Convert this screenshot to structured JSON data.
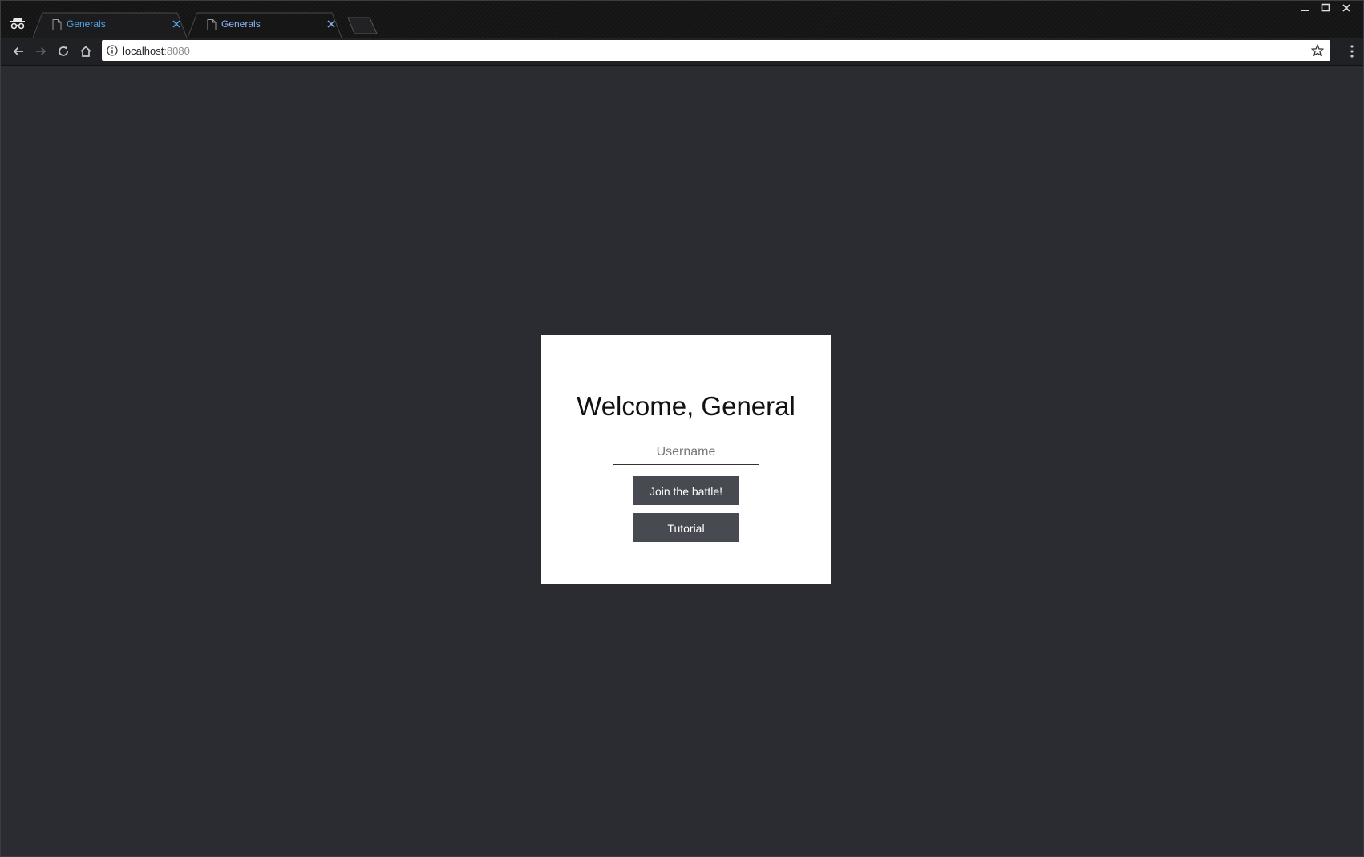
{
  "browser": {
    "tabs": [
      {
        "title": "Generals",
        "active": true
      },
      {
        "title": "Generals",
        "active": false
      }
    ],
    "address": {
      "host": "localhost",
      "port": ":8080"
    },
    "icons": {
      "incognito": "incognito-icon",
      "back": "back-arrow-icon",
      "forward": "forward-arrow-icon",
      "reload": "reload-icon",
      "home": "home-icon",
      "info": "info-icon",
      "bookmark": "star-icon",
      "menu": "kebab-menu-icon"
    },
    "colors": {
      "active_tab_text": "#4ea9ea",
      "page_background": "#2b2c32",
      "button_background": "#484a52"
    }
  },
  "page": {
    "title": "Welcome, General",
    "username_placeholder": "Username",
    "username_value": "",
    "join_label": "Join the battle!",
    "tutorial_label": "Tutorial"
  }
}
